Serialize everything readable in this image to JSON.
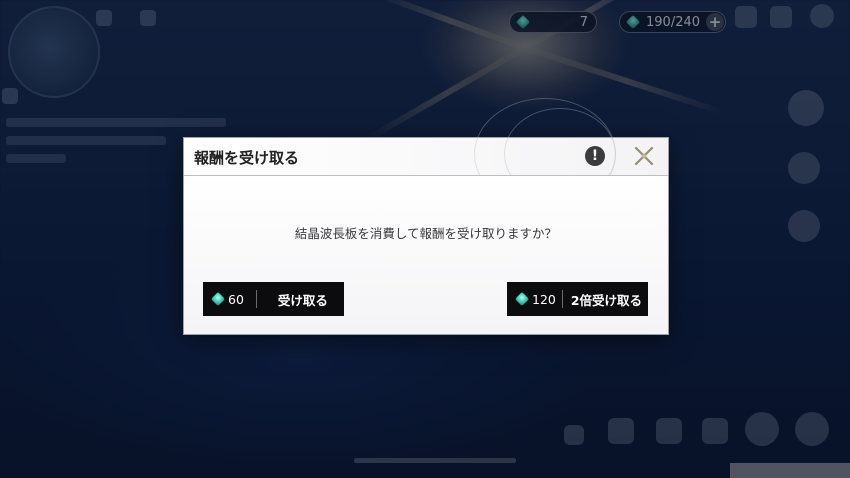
{
  "hud": {
    "currency_energy": {
      "icon": "crystal-chip-icon",
      "value": "7"
    },
    "currency_stamina": {
      "icon": "crystal-gem-icon",
      "value": "190/240",
      "add_label": "+"
    }
  },
  "dialog": {
    "title": "報酬を受け取る",
    "info_label": "!",
    "message": "結晶波長板を消費して報酬を受け取りますか？",
    "buttons": [
      {
        "icon": "crystal-gem-icon",
        "cost": "60",
        "label": "受け取る"
      },
      {
        "icon": "crystal-gem-icon",
        "cost": "120",
        "label": "2倍受け取る"
      }
    ]
  },
  "colors": {
    "dialog_bg": "#f6f6f7",
    "button_bg": "#0c0c0e",
    "gem_color": "#35c7b0"
  }
}
